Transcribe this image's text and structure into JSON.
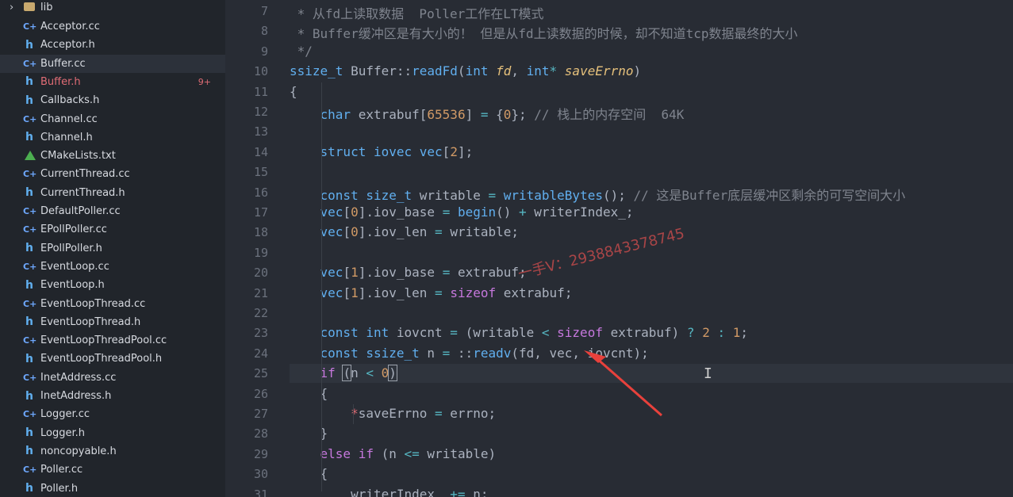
{
  "sidebar": {
    "folder": {
      "label": "lib"
    },
    "files": [
      {
        "name": "Acceptor.cc",
        "icon": "cpp-file-icon"
      },
      {
        "name": "Acceptor.h",
        "icon": "header-file-icon"
      },
      {
        "name": "Buffer.cc",
        "icon": "cpp-file-icon",
        "selected": true
      },
      {
        "name": "Buffer.h",
        "icon": "header-file-icon",
        "badge": "9+",
        "error": true
      },
      {
        "name": "Callbacks.h",
        "icon": "header-file-icon"
      },
      {
        "name": "Channel.cc",
        "icon": "cpp-file-icon"
      },
      {
        "name": "Channel.h",
        "icon": "header-file-icon"
      },
      {
        "name": "CMakeLists.txt",
        "icon": "cmake-file-icon"
      },
      {
        "name": "CurrentThread.cc",
        "icon": "cpp-file-icon"
      },
      {
        "name": "CurrentThread.h",
        "icon": "header-file-icon"
      },
      {
        "name": "DefaultPoller.cc",
        "icon": "cpp-file-icon"
      },
      {
        "name": "EPollPoller.cc",
        "icon": "cpp-file-icon"
      },
      {
        "name": "EPollPoller.h",
        "icon": "header-file-icon"
      },
      {
        "name": "EventLoop.cc",
        "icon": "cpp-file-icon"
      },
      {
        "name": "EventLoop.h",
        "icon": "header-file-icon"
      },
      {
        "name": "EventLoopThread.cc",
        "icon": "cpp-file-icon"
      },
      {
        "name": "EventLoopThread.h",
        "icon": "header-file-icon"
      },
      {
        "name": "EventLoopThreadPool.cc",
        "icon": "cpp-file-icon"
      },
      {
        "name": "EventLoopThreadPool.h",
        "icon": "header-file-icon"
      },
      {
        "name": "InetAddress.cc",
        "icon": "cpp-file-icon"
      },
      {
        "name": "InetAddress.h",
        "icon": "header-file-icon"
      },
      {
        "name": "Logger.cc",
        "icon": "cpp-file-icon"
      },
      {
        "name": "Logger.h",
        "icon": "header-file-icon"
      },
      {
        "name": "noncopyable.h",
        "icon": "header-file-icon"
      },
      {
        "name": "Poller.cc",
        "icon": "cpp-file-icon"
      },
      {
        "name": "Poller.h",
        "icon": "header-file-icon"
      }
    ]
  },
  "editor": {
    "current_line": 25,
    "lines": [
      {
        "n": "7",
        "tokens": [
          {
            "t": " * 从fd上读取数据  Poller工作在LT模式",
            "c": "t-cmt"
          }
        ]
      },
      {
        "n": "8",
        "tokens": [
          {
            "t": " * Buffer缓冲区是有大小的！ 但是从fd上读数据的时候，却不知道tcp数据最终的大小",
            "c": "t-cmt"
          }
        ]
      },
      {
        "n": "9",
        "tokens": [
          {
            "t": " */",
            "c": "t-cmt"
          }
        ]
      },
      {
        "n": "10",
        "tokens": [
          {
            "t": "ssize_t ",
            "c": "t-type"
          },
          {
            "t": "Buffer::",
            "c": "t-plain"
          },
          {
            "t": "readFd",
            "c": "t-fn"
          },
          {
            "t": "(",
            "c": "t-plain"
          },
          {
            "t": "int ",
            "c": "t-type"
          },
          {
            "t": "fd",
            "c": "t-param"
          },
          {
            "t": ", ",
            "c": "t-plain"
          },
          {
            "t": "int",
            "c": "t-type"
          },
          {
            "t": "* ",
            "c": "t-op"
          },
          {
            "t": "saveErrno",
            "c": "t-param"
          },
          {
            "t": ")",
            "c": "t-plain"
          }
        ]
      },
      {
        "n": "11",
        "tokens": [
          {
            "t": "{",
            "c": "t-plain"
          }
        ]
      },
      {
        "n": "12",
        "tokens": [
          {
            "t": "    char ",
            "c": "t-type"
          },
          {
            "t": "extrabuf",
            "c": "t-plain"
          },
          {
            "t": "[",
            "c": "t-plain"
          },
          {
            "t": "65536",
            "c": "t-num"
          },
          {
            "t": "] ",
            "c": "t-plain"
          },
          {
            "t": "= ",
            "c": "t-op"
          },
          {
            "t": "{",
            "c": "t-plain"
          },
          {
            "t": "0",
            "c": "t-num"
          },
          {
            "t": "}; ",
            "c": "t-plain"
          },
          {
            "t": "// 栈上的内存空间  64K",
            "c": "t-cmt"
          }
        ]
      },
      {
        "n": "13",
        "tokens": []
      },
      {
        "n": "14",
        "tokens": [
          {
            "t": "    struct ",
            "c": "t-type"
          },
          {
            "t": "iovec ",
            "c": "t-type"
          },
          {
            "t": "vec",
            "c": "t-type"
          },
          {
            "t": "[",
            "c": "t-plain"
          },
          {
            "t": "2",
            "c": "t-num"
          },
          {
            "t": "];",
            "c": "t-plain"
          }
        ]
      },
      {
        "n": "15",
        "tokens": []
      },
      {
        "n": "16",
        "tokens": [
          {
            "t": "    const ",
            "c": "t-type"
          },
          {
            "t": "size_t ",
            "c": "t-type"
          },
          {
            "t": "writable ",
            "c": "t-plain"
          },
          {
            "t": "= ",
            "c": "t-op"
          },
          {
            "t": "writableBytes",
            "c": "t-fn"
          },
          {
            "t": "(); ",
            "c": "t-plain"
          },
          {
            "t": "// 这是Buffer底层缓冲区剩余的可写空间大小",
            "c": "t-cmt"
          }
        ]
      },
      {
        "n": "17",
        "tokens": [
          {
            "t": "    vec",
            "c": "t-type"
          },
          {
            "t": "[",
            "c": "t-plain"
          },
          {
            "t": "0",
            "c": "t-num"
          },
          {
            "t": "].",
            "c": "t-plain"
          },
          {
            "t": "iov_base ",
            "c": "t-plain"
          },
          {
            "t": "= ",
            "c": "t-op"
          },
          {
            "t": "begin",
            "c": "t-fn"
          },
          {
            "t": "() ",
            "c": "t-plain"
          },
          {
            "t": "+ ",
            "c": "t-op"
          },
          {
            "t": "writerIndex_;",
            "c": "t-plain"
          }
        ]
      },
      {
        "n": "18",
        "tokens": [
          {
            "t": "    vec",
            "c": "t-type"
          },
          {
            "t": "[",
            "c": "t-plain"
          },
          {
            "t": "0",
            "c": "t-num"
          },
          {
            "t": "].",
            "c": "t-plain"
          },
          {
            "t": "iov_len ",
            "c": "t-plain"
          },
          {
            "t": "= ",
            "c": "t-op"
          },
          {
            "t": "writable;",
            "c": "t-plain"
          }
        ]
      },
      {
        "n": "19",
        "tokens": []
      },
      {
        "n": "20",
        "tokens": [
          {
            "t": "    vec",
            "c": "t-type"
          },
          {
            "t": "[",
            "c": "t-plain"
          },
          {
            "t": "1",
            "c": "t-num"
          },
          {
            "t": "].",
            "c": "t-plain"
          },
          {
            "t": "iov_base ",
            "c": "t-plain"
          },
          {
            "t": "= ",
            "c": "t-op"
          },
          {
            "t": "extrabuf;",
            "c": "t-plain"
          }
        ]
      },
      {
        "n": "21",
        "tokens": [
          {
            "t": "    vec",
            "c": "t-type"
          },
          {
            "t": "[",
            "c": "t-plain"
          },
          {
            "t": "1",
            "c": "t-num"
          },
          {
            "t": "].",
            "c": "t-plain"
          },
          {
            "t": "iov_len ",
            "c": "t-plain"
          },
          {
            "t": "= ",
            "c": "t-op"
          },
          {
            "t": "sizeof ",
            "c": "t-kw"
          },
          {
            "t": "extrabuf;",
            "c": "t-plain"
          }
        ]
      },
      {
        "n": "22",
        "tokens": []
      },
      {
        "n": "23",
        "tokens": [
          {
            "t": "    const ",
            "c": "t-type"
          },
          {
            "t": "int ",
            "c": "t-type"
          },
          {
            "t": "iovcnt ",
            "c": "t-plain"
          },
          {
            "t": "= ",
            "c": "t-op"
          },
          {
            "t": "(writable ",
            "c": "t-plain"
          },
          {
            "t": "< ",
            "c": "t-op"
          },
          {
            "t": "sizeof ",
            "c": "t-kw"
          },
          {
            "t": "extrabuf) ",
            "c": "t-plain"
          },
          {
            "t": "? ",
            "c": "t-op"
          },
          {
            "t": "2 ",
            "c": "t-num"
          },
          {
            "t": ": ",
            "c": "t-op"
          },
          {
            "t": "1",
            "c": "t-num"
          },
          {
            "t": ";",
            "c": "t-plain"
          }
        ]
      },
      {
        "n": "24",
        "tokens": [
          {
            "t": "    const ",
            "c": "t-type"
          },
          {
            "t": "ssize_t ",
            "c": "t-type"
          },
          {
            "t": "n ",
            "c": "t-plain"
          },
          {
            "t": "= ",
            "c": "t-op"
          },
          {
            "t": "::",
            "c": "t-plain"
          },
          {
            "t": "readv",
            "c": "t-fn"
          },
          {
            "t": "(fd, vec, iovcnt);",
            "c": "t-plain"
          }
        ]
      },
      {
        "n": "25",
        "tokens": [
          {
            "t": "    if ",
            "c": "t-kw"
          },
          {
            "t": "(",
            "c": "t-bracket"
          },
          {
            "t": "n ",
            "c": "t-plain"
          },
          {
            "t": "< ",
            "c": "t-op"
          },
          {
            "t": "0",
            "c": "t-num"
          },
          {
            "t": ")",
            "c": "t-bracket"
          }
        ]
      },
      {
        "n": "26",
        "tokens": [
          {
            "t": "    {",
            "c": "t-plain"
          }
        ]
      },
      {
        "n": "27",
        "tokens": [
          {
            "t": "        *",
            "c": "t-red"
          },
          {
            "t": "saveErrno ",
            "c": "t-plain"
          },
          {
            "t": "= ",
            "c": "t-op"
          },
          {
            "t": "errno;",
            "c": "t-plain"
          }
        ]
      },
      {
        "n": "28",
        "tokens": [
          {
            "t": "    }",
            "c": "t-plain"
          }
        ]
      },
      {
        "n": "29",
        "tokens": [
          {
            "t": "    else ",
            "c": "t-kw"
          },
          {
            "t": "if ",
            "c": "t-kw"
          },
          {
            "t": "(n ",
            "c": "t-plain"
          },
          {
            "t": "<= ",
            "c": "t-op"
          },
          {
            "t": "writable)",
            "c": "t-plain"
          }
        ]
      },
      {
        "n": "30",
        "tokens": [
          {
            "t": "    {",
            "c": "t-plain"
          }
        ]
      },
      {
        "n": "31",
        "tokens": [
          {
            "t": "        writerIndex_ ",
            "c": "t-plain"
          },
          {
            "t": "+= ",
            "c": "t-op"
          },
          {
            "t": "n;",
            "c": "t-plain"
          }
        ]
      }
    ]
  },
  "watermark": {
    "text": "一手V：2938843378745"
  },
  "colors": {
    "accent_arrow": "#e8413c",
    "error": "#e06c75"
  }
}
